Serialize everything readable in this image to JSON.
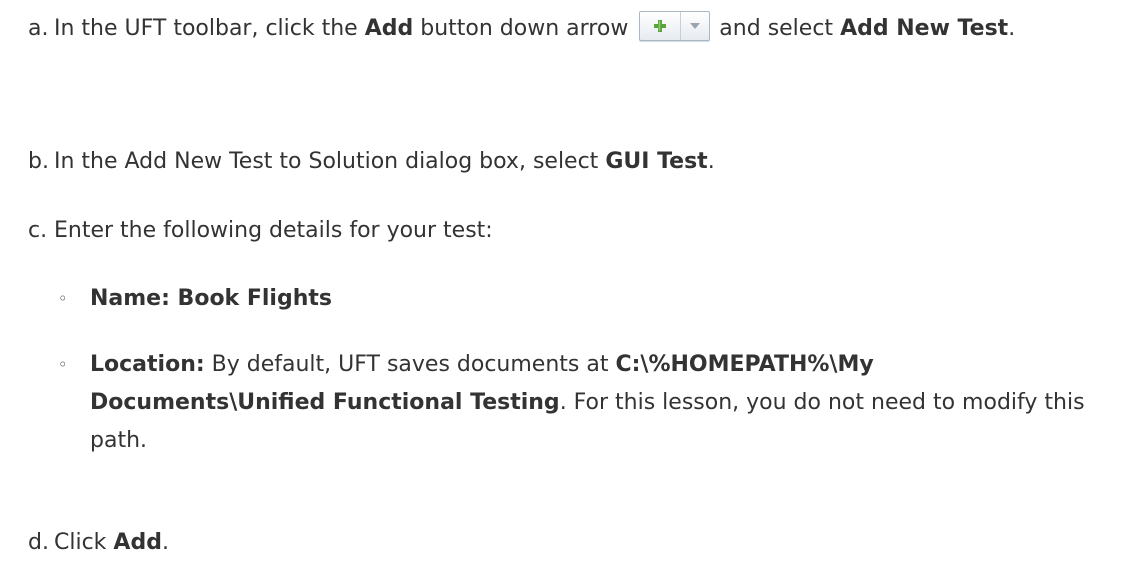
{
  "steps": [
    {
      "marker": "a.",
      "pre": "In the UFT toolbar, click the ",
      "bold1": "Add",
      "mid": " button down arrow ",
      "post": " and select ",
      "bold2": "Add New Test",
      "end": "."
    },
    {
      "marker": "b.",
      "pre": "In the Add New Test to Solution dialog box, select ",
      "bold1": "GUI Test",
      "end": "."
    },
    {
      "marker": "c.",
      "pre": "Enter the following details for your test:"
    },
    {
      "marker": "d.",
      "pre": "Click ",
      "bold1": "Add",
      "end": "."
    }
  ],
  "details": [
    {
      "bullet": "◦",
      "label": "Name: Book Flights"
    },
    {
      "bullet": "◦",
      "label": "Location:",
      "pre": " By default, UFT saves documents at ",
      "path": "C:\\%HOMEPATH%\\My Documents\\Unified Functional Testing",
      "post": ". For this lesson, you do not need to modify this path."
    }
  ],
  "toolbar_button": {
    "icons": [
      "plus-icon",
      "dropdown-arrow-icon"
    ],
    "plus_color": "#5aa33c",
    "arrow_color": "#9aa5b0"
  }
}
